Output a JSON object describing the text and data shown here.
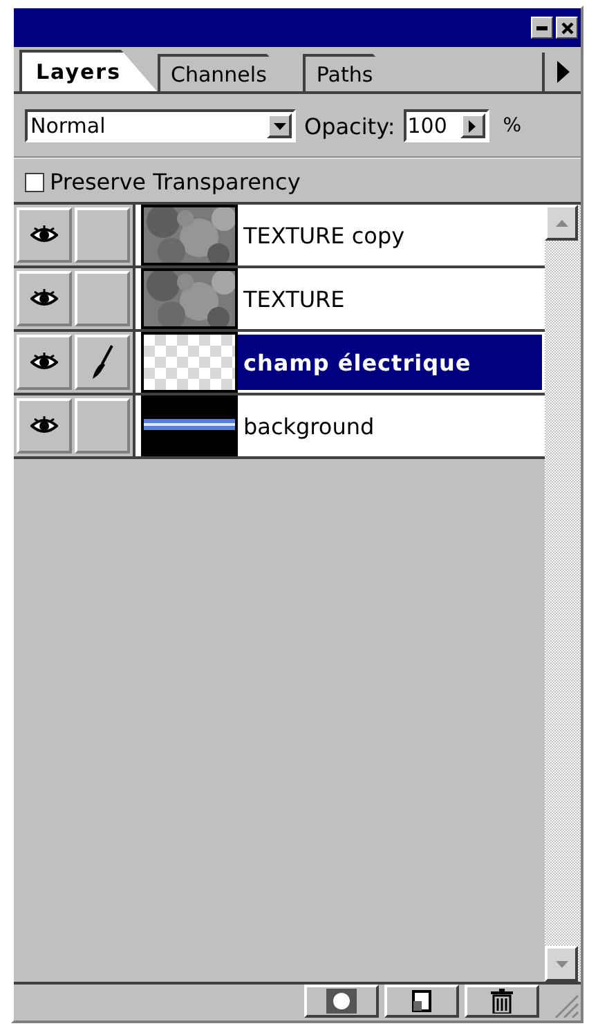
{
  "tabs": [
    {
      "label": "Layers",
      "selected": true
    },
    {
      "label": "Channels",
      "selected": false
    },
    {
      "label": "Paths",
      "selected": false
    }
  ],
  "blend_mode": {
    "value": "Normal"
  },
  "opacity": {
    "label": "Opacity:",
    "value": "100",
    "unit": "%"
  },
  "preserve_transparency": {
    "label": "Preserve Transparency",
    "checked": false
  },
  "layers": [
    {
      "name": "TEXTURE copy",
      "kind": "texture",
      "visible": true,
      "editing": false,
      "selected": false
    },
    {
      "name": "TEXTURE",
      "kind": "texture",
      "visible": true,
      "editing": false,
      "selected": false
    },
    {
      "name": "champ électrique",
      "kind": "transparent",
      "visible": true,
      "editing": true,
      "selected": true
    },
    {
      "name": "background",
      "kind": "stripe",
      "visible": true,
      "editing": false,
      "selected": false
    }
  ]
}
